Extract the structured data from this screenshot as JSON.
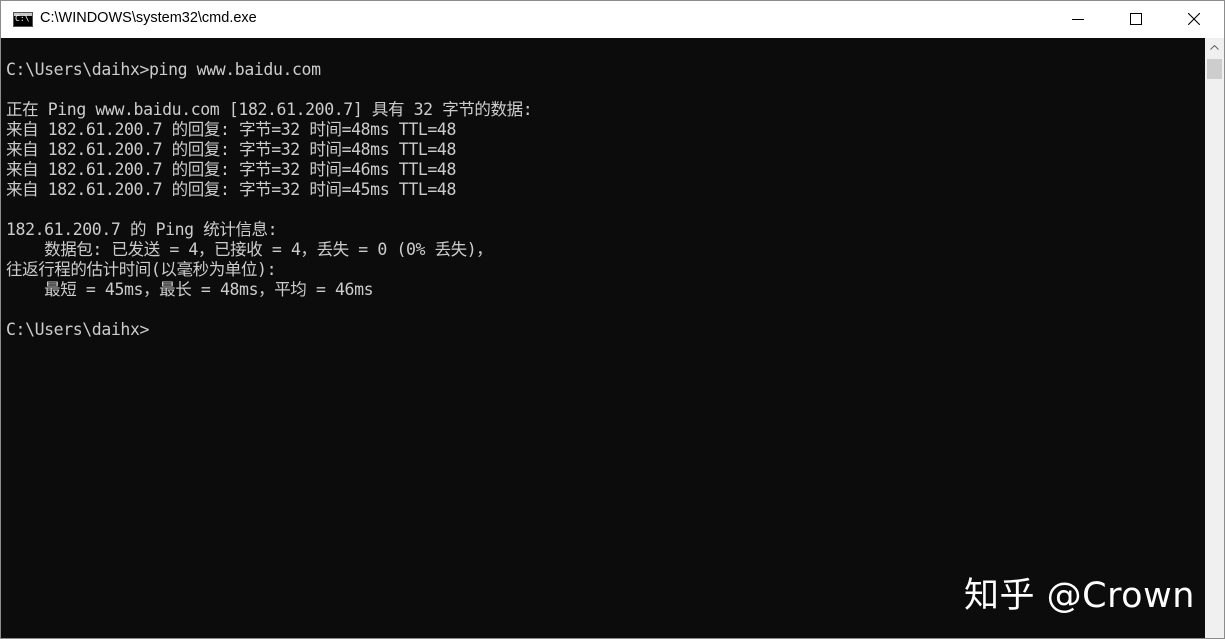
{
  "window": {
    "title": "C:\\WINDOWS\\system32\\cmd.exe",
    "icon": "cmd-icon",
    "icon_glyph": "C:\\"
  },
  "controls": {
    "minimize_icon": "minimize-icon",
    "maximize_icon": "maximize-icon",
    "close_icon": "close-icon"
  },
  "console": {
    "lines": [
      "C:\\Users\\daihx>ping www.baidu.com",
      "",
      "正在 Ping www.baidu.com [182.61.200.7] 具有 32 字节的数据:",
      "来自 182.61.200.7 的回复: 字节=32 时间=48ms TTL=48",
      "来自 182.61.200.7 的回复: 字节=32 时间=48ms TTL=48",
      "来自 182.61.200.7 的回复: 字节=32 时间=46ms TTL=48",
      "来自 182.61.200.7 的回复: 字节=32 时间=45ms TTL=48",
      "",
      "182.61.200.7 的 Ping 统计信息:",
      "    数据包: 已发送 = 4，已接收 = 4，丢失 = 0 (0% 丢失)，",
      "往返行程的估计时间(以毫秒为单位):",
      "    最短 = 45ms，最长 = 48ms，平均 = 46ms",
      "",
      "C:\\Users\\daihx>"
    ]
  },
  "watermark": "知乎 @Crown",
  "colors": {
    "console_bg": "#0c0c0c",
    "console_fg": "#cccccc",
    "titlebar_bg": "#ffffff"
  }
}
